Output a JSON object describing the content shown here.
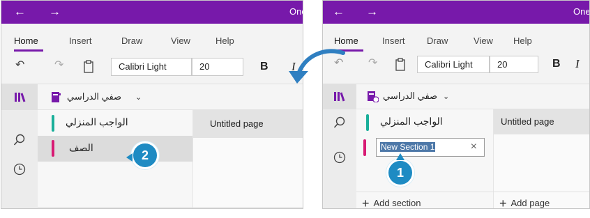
{
  "app": {
    "title_fragment": "One",
    "back": "←",
    "forward": "→"
  },
  "menu": [
    "Home",
    "Insert",
    "Draw",
    "View",
    "Help"
  ],
  "toolbar": {
    "font_name": "Calibri Light",
    "font_size": "20",
    "bold": "B",
    "italic": "I"
  },
  "notebook": {
    "name": "صفي الدراسي"
  },
  "sections": [
    {
      "name": "الواجب المنزلي",
      "color": "#1aaf9a"
    },
    {
      "name": "الصف",
      "color": "#d81b74"
    }
  ],
  "new_section_value": "New Section 1",
  "clear_x": "×",
  "page": {
    "title": "Untitled page"
  },
  "add_section_label": "Add section",
  "add_page_label": "Add page",
  "steps": {
    "one": "1",
    "two": "2"
  },
  "colors": {
    "accent": "#7719aa",
    "badge": "#1e8bc3",
    "arrow": "#2f7fc1"
  }
}
